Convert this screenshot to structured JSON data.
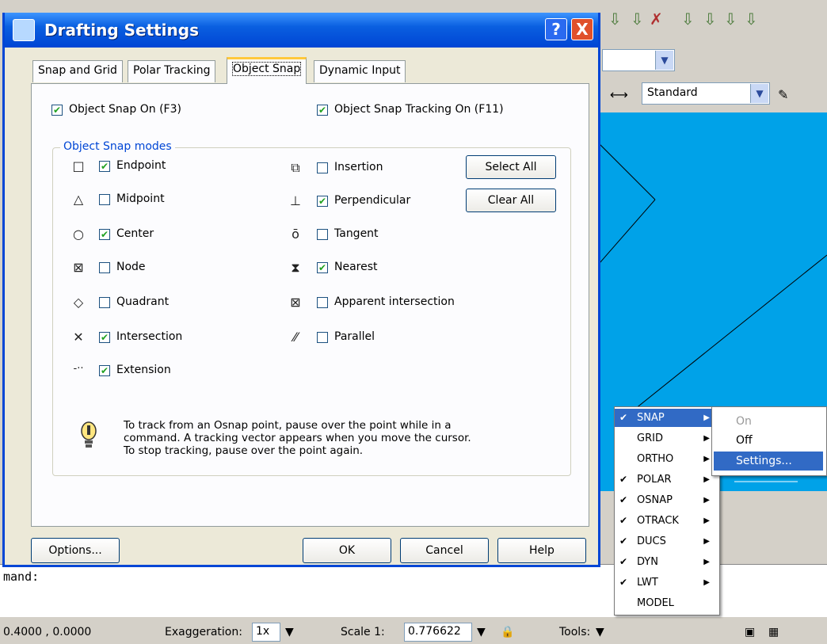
{
  "dialog": {
    "title": "Drafting Settings",
    "help_glyph": "?",
    "close_glyph": "X",
    "tabs": [
      {
        "label": "Snap and Grid"
      },
      {
        "label": "Polar Tracking"
      },
      {
        "label": "Object Snap"
      },
      {
        "label": "Dynamic Input"
      }
    ],
    "active_tab": "Object Snap",
    "osnap_on": {
      "label": "Object Snap On (F3)",
      "checked": true
    },
    "otrack_on": {
      "label": "Object Snap Tracking On (F11)",
      "checked": true
    },
    "group_title": "Object Snap modes",
    "modes_left": [
      {
        "label": "Endpoint",
        "checked": true,
        "icon": "□"
      },
      {
        "label": "Midpoint",
        "checked": false,
        "icon": "△"
      },
      {
        "label": "Center",
        "checked": true,
        "icon": "○"
      },
      {
        "label": "Node",
        "checked": false,
        "icon": "⊠"
      },
      {
        "label": "Quadrant",
        "checked": false,
        "icon": "◇"
      },
      {
        "label": "Intersection",
        "checked": true,
        "icon": "✕"
      },
      {
        "label": "Extension",
        "checked": true,
        "icon": "-··"
      }
    ],
    "modes_right": [
      {
        "label": "Insertion",
        "checked": false,
        "icon": "⧉"
      },
      {
        "label": "Perpendicular",
        "checked": true,
        "icon": "⊥"
      },
      {
        "label": "Tangent",
        "checked": false,
        "icon": "ō"
      },
      {
        "label": "Nearest",
        "checked": true,
        "icon": "⧗"
      },
      {
        "label": "Apparent intersection",
        "checked": false,
        "icon": "⊠"
      },
      {
        "label": "Parallel",
        "checked": false,
        "icon": "⁄⁄"
      }
    ],
    "select_all": "Select All",
    "clear_all": "Clear All",
    "tip_lines": [
      "To track from an Osnap point, pause over the point while in a",
      "command.  A tracking vector appears when you move the cursor.",
      "To stop tracking, pause over the point again."
    ],
    "options_btn": "Options...",
    "ok_btn": "OK",
    "cancel_btn": "Cancel",
    "help_btn": "Help"
  },
  "toolbar": {
    "style_combo": "Standard"
  },
  "command_line": "mand:",
  "statusbar": {
    "coords": "0.4000 , 0.0000",
    "exaggeration_label": "Exaggeration:",
    "exaggeration_value": "1x",
    "scale_label": "Scale 1:",
    "scale_value": "0.776622",
    "tools_label": "Tools:"
  },
  "context_menu": {
    "items": [
      {
        "label": "SNAP",
        "checked": true,
        "submenu": true,
        "highlighted": true
      },
      {
        "label": "GRID",
        "checked": false,
        "submenu": true
      },
      {
        "label": "ORTHO",
        "checked": false,
        "submenu": true
      },
      {
        "label": "POLAR",
        "checked": true,
        "submenu": true
      },
      {
        "label": "OSNAP",
        "checked": true,
        "submenu": true
      },
      {
        "label": "OTRACK",
        "checked": true,
        "submenu": true
      },
      {
        "label": "DUCS",
        "checked": true,
        "submenu": true
      },
      {
        "label": "DYN",
        "checked": true,
        "submenu": true
      },
      {
        "label": "LWT",
        "checked": true,
        "submenu": true
      },
      {
        "label": "MODEL",
        "checked": false,
        "submenu": false
      }
    ],
    "check_glyph": "✔",
    "submenu_glyph": "▶",
    "submenu": [
      {
        "label": "On",
        "disabled": true
      },
      {
        "label": "Off",
        "disabled": false
      },
      {
        "label": "Settings...",
        "highlighted": true
      }
    ]
  }
}
